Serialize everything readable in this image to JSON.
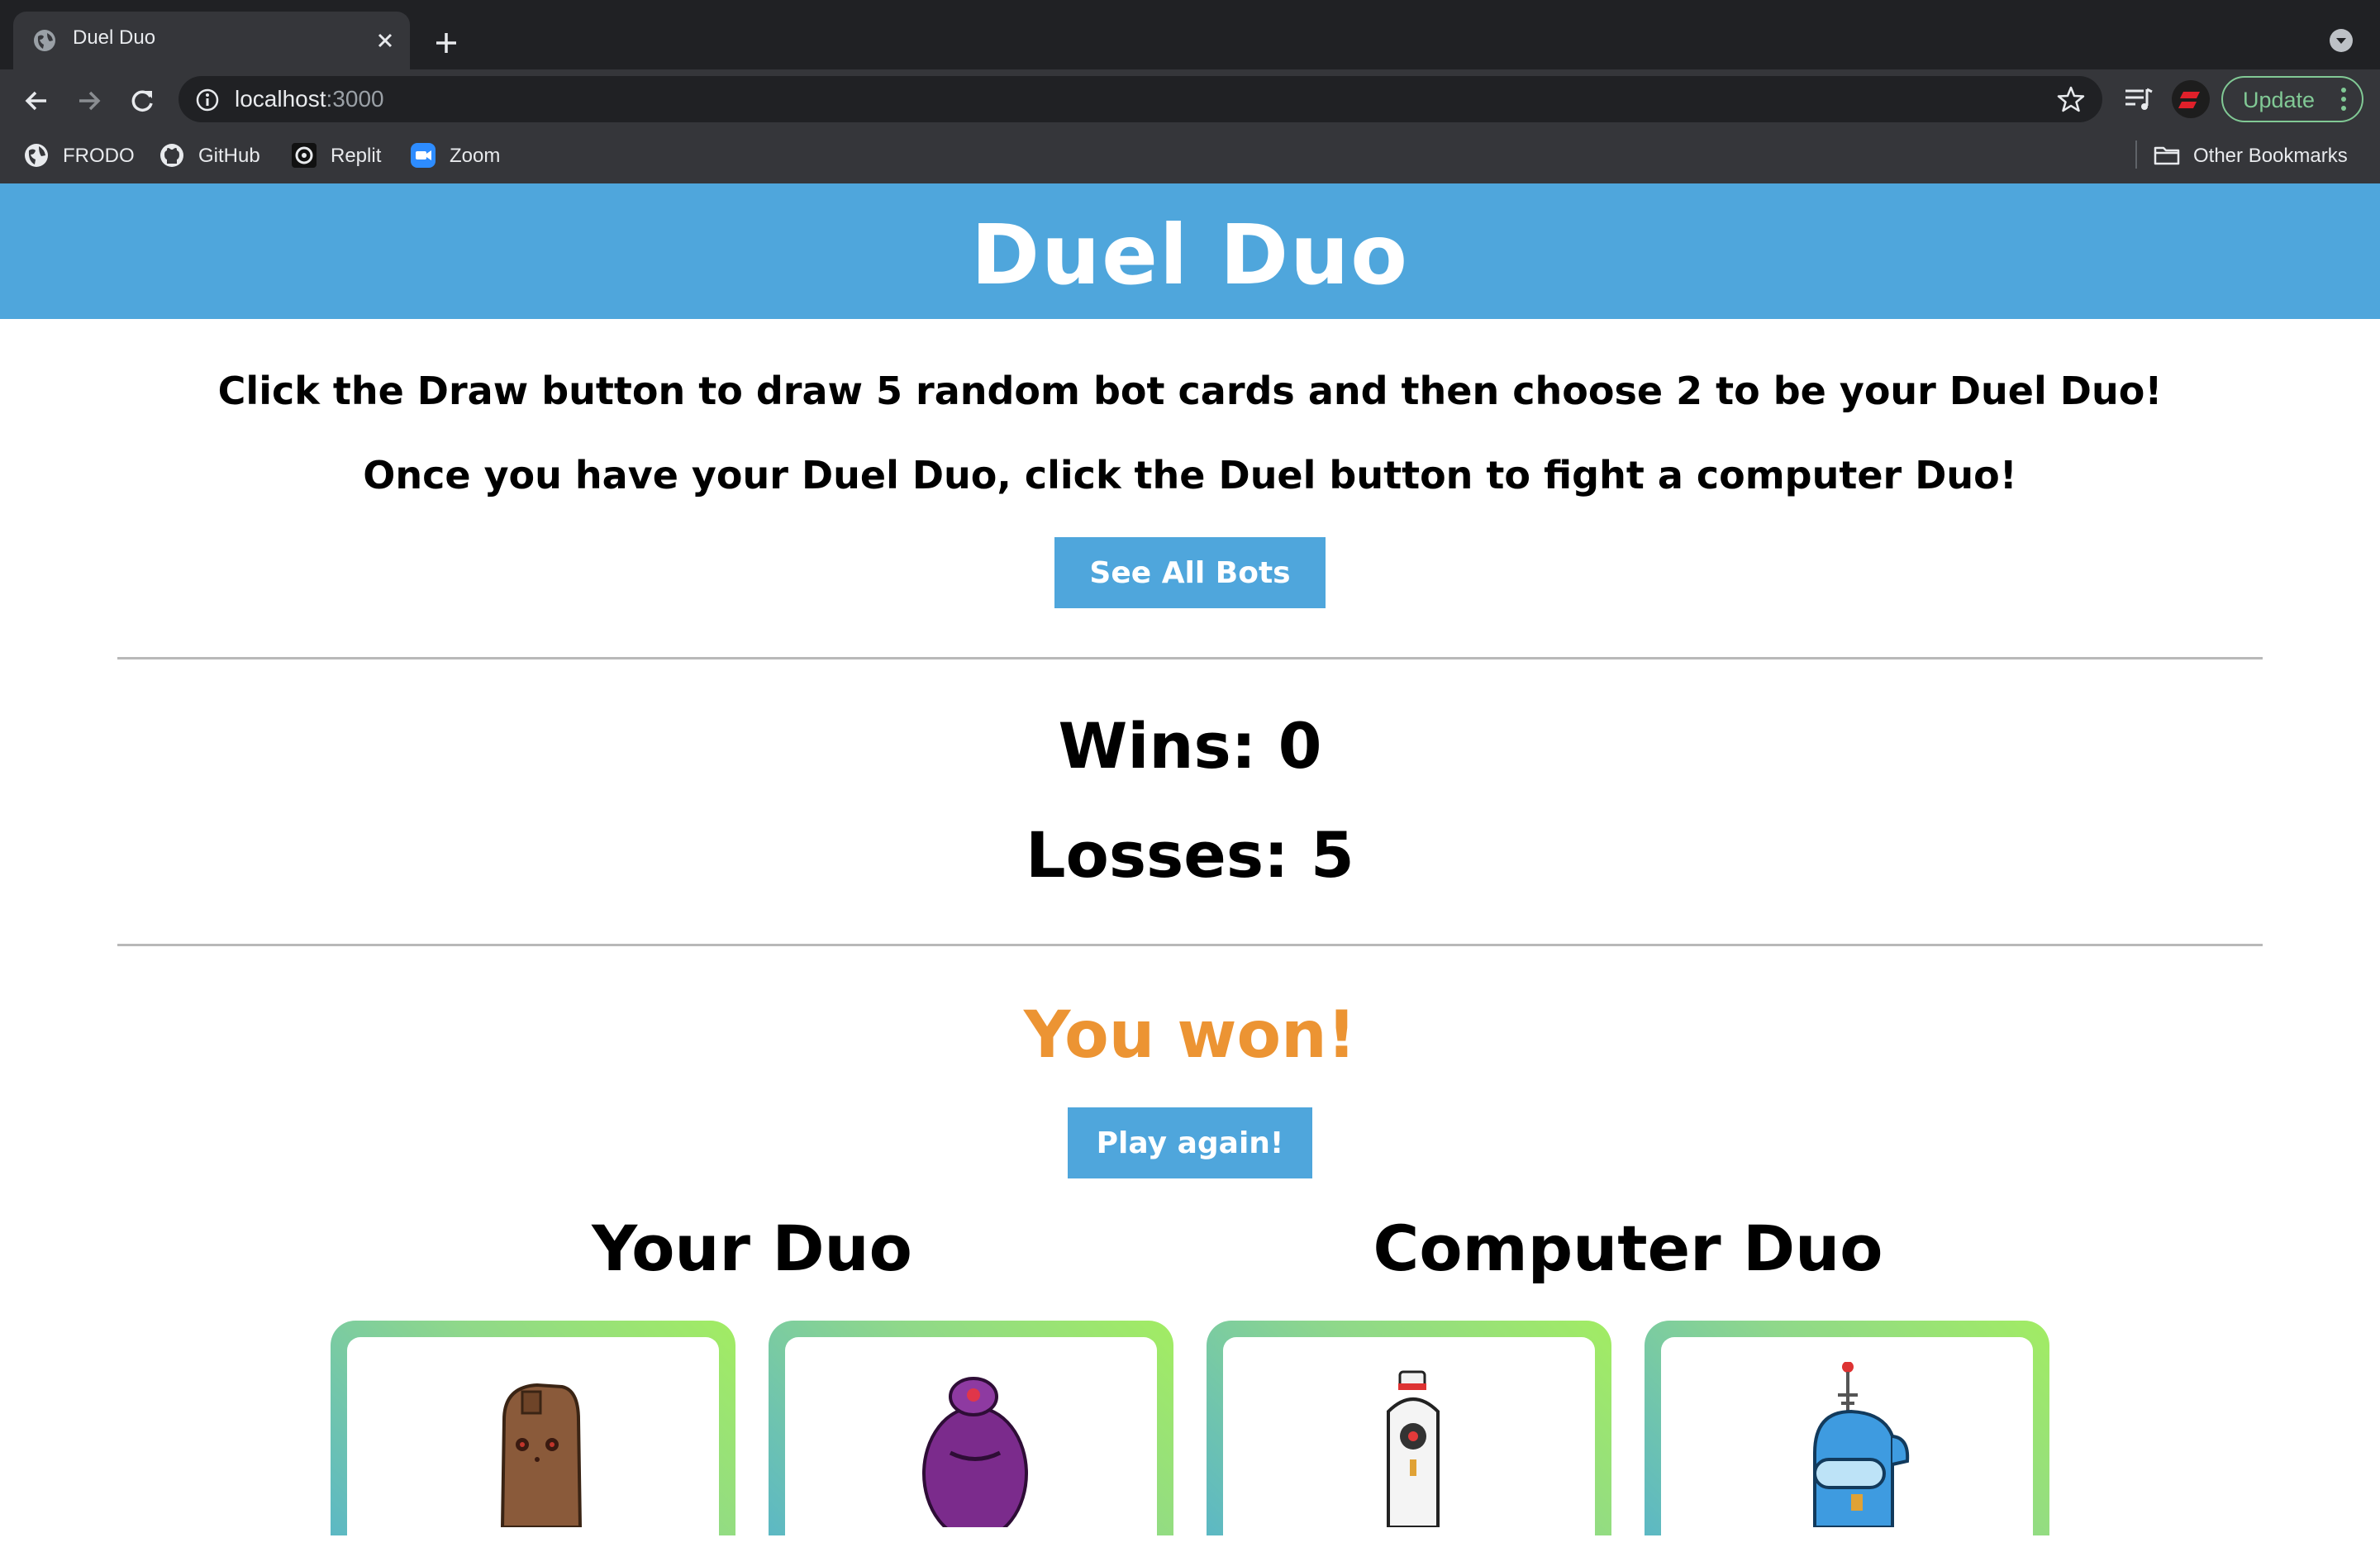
{
  "browser": {
    "tab_title": "Duel Duo",
    "url_host": "localhost",
    "url_port": ":3000",
    "update_label": "Update",
    "bookmarks": [
      {
        "label": "FRODO",
        "icon": "globe-icon"
      },
      {
        "label": "GitHub",
        "icon": "github-icon"
      },
      {
        "label": "Replit",
        "icon": "replit-icon"
      },
      {
        "label": "Zoom",
        "icon": "zoom-icon"
      }
    ],
    "other_bookmarks": "Other Bookmarks"
  },
  "page": {
    "title": "Duel Duo",
    "instruction_1": "Click the Draw button to draw 5 random bot cards and then choose 2 to be your Duel Duo!",
    "instruction_2": "Once you have your Duel Duo, click the Duel button to fight a computer Duo!",
    "see_all_label": "See All Bots",
    "wins": "Wins: 0",
    "losses": "Losses: 5",
    "result": "You won!",
    "play_again_label": "Play again!",
    "your_duo_title": "Your Duo",
    "computer_duo_title": "Computer Duo"
  },
  "colors": {
    "header": "#4fa6dc",
    "button": "#4fa6dc",
    "result": "#ec9433",
    "card_gradient_start": "#5cb8c4",
    "card_gradient_end": "#a2ec63"
  },
  "cards": [
    {
      "owner": "player",
      "bot_icon": "brown-robot-icon"
    },
    {
      "owner": "player",
      "bot_icon": "purple-robot-icon"
    },
    {
      "owner": "computer",
      "bot_icon": "white-robot-icon"
    },
    {
      "owner": "computer",
      "bot_icon": "blue-robot-icon"
    }
  ]
}
